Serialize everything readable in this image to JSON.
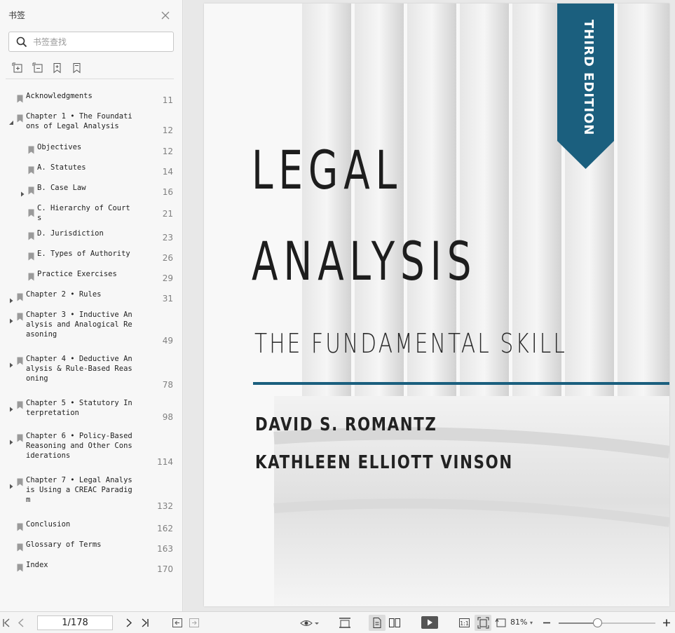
{
  "sidebar": {
    "title": "书签",
    "search_placeholder": "书签查找",
    "bookmarks": [
      {
        "label": "Acknowledgments",
        "page": "11",
        "level": 0,
        "arrow": "none"
      },
      {
        "label": "Chapter 1 • The Foundati\nons of Legal Analysis",
        "page": "12",
        "level": 0,
        "arrow": "expanded"
      },
      {
        "label": "Objectives",
        "page": "12",
        "level": 1,
        "arrow": "none"
      },
      {
        "label": "A. Statutes",
        "page": "14",
        "level": 1,
        "arrow": "none"
      },
      {
        "label": "B. Case Law",
        "page": "16",
        "level": 1,
        "arrow": "collapsed"
      },
      {
        "label": "C. Hierarchy of Court\ns",
        "page": "21",
        "level": 1,
        "arrow": "none"
      },
      {
        "label": "D. Jurisdiction",
        "page": "23",
        "level": 1,
        "arrow": "none"
      },
      {
        "label": "E. Types of Authority",
        "page": "26",
        "level": 1,
        "arrow": "none"
      },
      {
        "label": "Practice Exercises",
        "page": "29",
        "level": 1,
        "arrow": "none"
      },
      {
        "label": "Chapter 2 • Rules",
        "page": "31",
        "level": 0,
        "arrow": "collapsed"
      },
      {
        "label": "Chapter 3 • Inductive An\nalysis and Analogical Re\nasoning",
        "page": "49",
        "level": 0,
        "arrow": "collapsed"
      },
      {
        "label": "Chapter 4 • Deductive An\nalysis & Rule-Based Reas\noning",
        "page": "78",
        "level": 0,
        "arrow": "collapsed"
      },
      {
        "label": "Chapter 5 • Statutory In\nterpretation",
        "page": "98",
        "level": 0,
        "arrow": "collapsed"
      },
      {
        "label": "Chapter 6 • Policy-Based\nReasoning and Other Cons\niderations",
        "page": "114",
        "level": 0,
        "arrow": "collapsed"
      },
      {
        "label": "Chapter 7 • Legal Analys\nis Using a CREAC Paradig\nm",
        "page": "132",
        "level": 0,
        "arrow": "collapsed"
      },
      {
        "label": "Conclusion",
        "page": "162",
        "level": 0,
        "arrow": "none"
      },
      {
        "label": "Glossary of Terms",
        "page": "163",
        "level": 0,
        "arrow": "none"
      },
      {
        "label": "Index",
        "page": "170",
        "level": 0,
        "arrow": "none"
      }
    ]
  },
  "cover": {
    "edition": "THIRD EDITION",
    "title_line1": "LEGAL",
    "title_line2": "ANALYSIS",
    "subtitle": "THE FUNDAMENTAL SKILL",
    "author1": "DAVID S. ROMANTZ",
    "author2": "KATHLEEN ELLIOTT VINSON",
    "accent_color": "#1b5f7e"
  },
  "toolbar": {
    "page_indicator": "1/178",
    "zoom": "81%",
    "zoom_fraction": 0.4,
    "icons": [
      "first-page-icon",
      "prev-page-icon",
      "next-page-icon",
      "last-page-icon",
      "back-icon",
      "forward-icon",
      "read-mode-icon",
      "fit-width-icon",
      "single-page-icon",
      "two-page-icon",
      "play-icon",
      "actual-size-icon",
      "fit-page-icon",
      "rotate-icon",
      "zoom-out-icon",
      "zoom-in-icon"
    ]
  }
}
